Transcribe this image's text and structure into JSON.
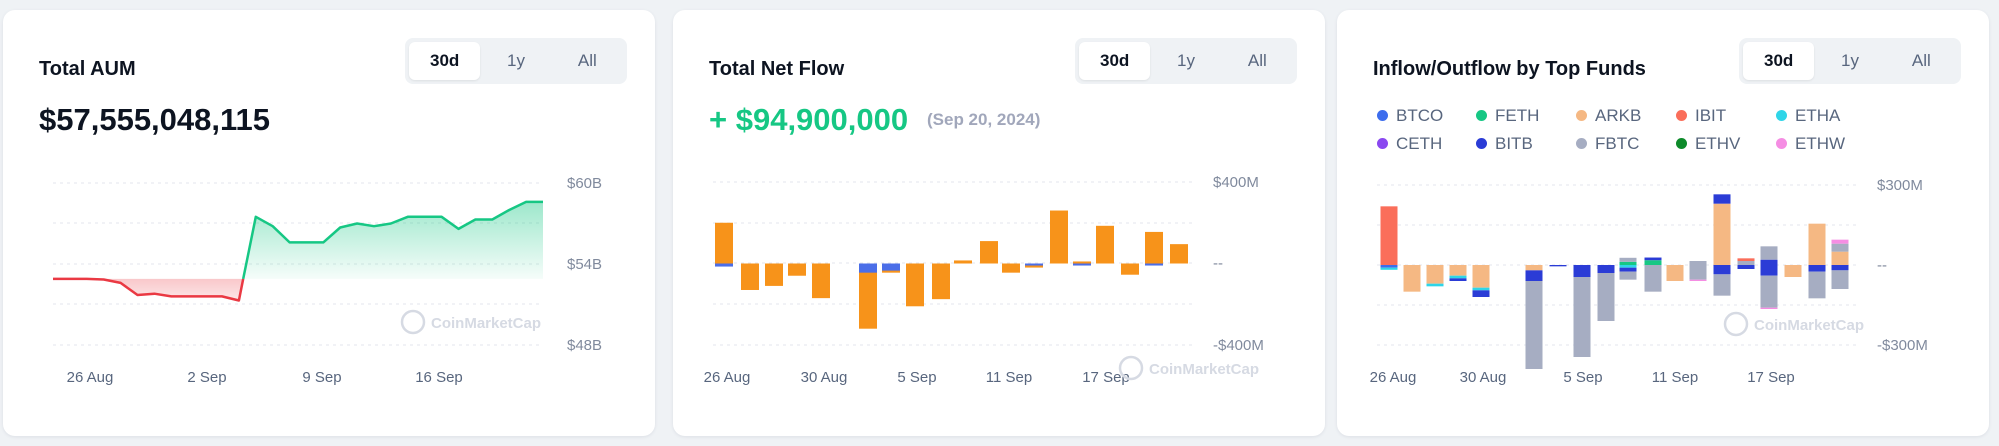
{
  "cards": {
    "aum": {
      "title": "Total AUM",
      "value": "$57,555,048,115",
      "tabs": [
        "30d",
        "1y",
        "All"
      ],
      "active_tab": "30d",
      "watermark": "CoinMarketCap"
    },
    "netflow": {
      "title": "Total Net Flow",
      "value": "+ $94,900,000",
      "date": "(Sep 20, 2024)",
      "tabs": [
        "30d",
        "1y",
        "All"
      ],
      "active_tab": "30d",
      "watermark": "CoinMarketCap"
    },
    "funds": {
      "title": "Inflow/Outflow by Top Funds",
      "tabs": [
        "30d",
        "1y",
        "All"
      ],
      "active_tab": "30d",
      "watermark": "CoinMarketCap"
    }
  },
  "colors": {
    "green": "#16c784",
    "red": "#ea3943",
    "orange": "#f7931a",
    "blue_bar": "#4b6ee8",
    "muted": "#58667e"
  },
  "chart_data": [
    {
      "type": "area",
      "title": "Total AUM",
      "xlabel": "",
      "ylabel": "",
      "x_ticks": [
        "26 Aug",
        "2 Sep",
        "9 Sep",
        "16 Sep"
      ],
      "y_ticks": [
        "$60B",
        "$54B",
        "$48B"
      ],
      "ylim": [
        48,
        60
      ],
      "baseline": 52.9,
      "grid": true,
      "x": [
        "25 Aug",
        "26 Aug",
        "27 Aug",
        "28 Aug",
        "29 Aug",
        "30 Aug",
        "31 Aug",
        "1 Sep",
        "2 Sep",
        "3 Sep",
        "4 Sep",
        "5 Sep",
        "6 Sep",
        "7 Sep",
        "8 Sep",
        "9 Sep",
        "10 Sep",
        "11 Sep",
        "12 Sep",
        "13 Sep",
        "14 Sep",
        "15 Sep",
        "16 Sep",
        "17 Sep",
        "18 Sep",
        "19 Sep",
        "20 Sep",
        "21 Sep",
        "22 Sep",
        "23 Sep"
      ],
      "values": [
        52.9,
        52.9,
        52.9,
        52.85,
        52.6,
        51.7,
        51.8,
        51.6,
        51.6,
        51.6,
        51.6,
        51.3,
        57.5,
        56.8,
        55.6,
        55.6,
        55.6,
        56.7,
        57.0,
        56.8,
        57.0,
        57.5,
        57.5,
        57.5,
        56.6,
        57.3,
        57.3,
        58.0,
        58.6,
        58.6
      ],
      "series_colors": {
        "down": "#ea3943",
        "up": "#16c784"
      }
    },
    {
      "type": "bar",
      "title": "Total Net Flow",
      "xlabel": "",
      "ylabel": "",
      "x_ticks": [
        "26 Aug",
        "30 Aug",
        "5 Sep",
        "11 Sep",
        "17 Sep"
      ],
      "y_ticks": [
        "$400M",
        "--",
        "-$400M"
      ],
      "ylim": [
        -400,
        400
      ],
      "grid": true,
      "x": [
        "23 Aug",
        "26 Aug",
        "27 Aug",
        "28 Aug",
        "29 Aug",
        "30 Aug",
        "3 Sep",
        "4 Sep",
        "5 Sep",
        "6 Sep",
        "9 Sep",
        "10 Sep",
        "11 Sep",
        "12 Sep",
        "13 Sep",
        "16 Sep",
        "17 Sep",
        "18 Sep",
        "19 Sep",
        "20 Sep"
      ],
      "series": [
        {
          "name": "",
          "color": "#f7931a",
          "values": [
            200,
            -130,
            -110,
            -60,
            -170,
            0,
            -320,
            -45,
            -210,
            -175,
            15,
            110,
            -45,
            -20,
            260,
            10,
            185,
            -55,
            155,
            95
          ]
        },
        {
          "name": "",
          "color": "#4b6ee8",
          "values": [
            -15,
            0,
            0,
            0,
            0,
            0,
            -45,
            -35,
            0,
            0,
            0,
            0,
            0,
            -10,
            0,
            -10,
            0,
            0,
            -10,
            0
          ]
        }
      ]
    },
    {
      "type": "bar",
      "stacked": true,
      "title": "Inflow/Outflow by Top Funds",
      "xlabel": "",
      "ylabel": "",
      "legend_position": "top",
      "x_ticks": [
        "26 Aug",
        "30 Aug",
        "5 Sep",
        "11 Sep",
        "17 Sep"
      ],
      "y_ticks": [
        "$300M",
        "--",
        "-$300M"
      ],
      "ylim": [
        -300,
        300
      ],
      "grid": true,
      "x": [
        "23 Aug",
        "26 Aug",
        "27 Aug",
        "28 Aug",
        "29 Aug",
        "30 Aug",
        "3 Sep",
        "4 Sep",
        "5 Sep",
        "6 Sep",
        "9 Sep",
        "10 Sep",
        "11 Sep",
        "12 Sep",
        "13 Sep",
        "16 Sep",
        "17 Sep",
        "18 Sep",
        "19 Sep",
        "20 Sep"
      ],
      "series": [
        {
          "name": "BTCO",
          "color": "#3d6ded",
          "values": [
            -10,
            0,
            0,
            0,
            0,
            0,
            0,
            0,
            0,
            0,
            0,
            0,
            0,
            0,
            0,
            0,
            0,
            0,
            0,
            0
          ]
        },
        {
          "name": "FETH",
          "color": "#16c784",
          "values": [
            0,
            0,
            0,
            0,
            0,
            0,
            0,
            0,
            0,
            0,
            12,
            18,
            0,
            0,
            0,
            0,
            0,
            0,
            0,
            0
          ]
        },
        {
          "name": "ARKB",
          "color": "#f5b883",
          "values": [
            0,
            -100,
            -70,
            -40,
            -85,
            0,
            -20,
            0,
            0,
            0,
            0,
            0,
            -60,
            0,
            230,
            0,
            0,
            -45,
            155,
            50
          ]
        },
        {
          "name": "IBIT",
          "color": "#fa6e5a",
          "values": [
            220,
            0,
            0,
            0,
            0,
            0,
            0,
            0,
            0,
            0,
            0,
            0,
            0,
            0,
            0,
            0,
            0,
            0,
            0,
            0
          ]
        },
        {
          "name": "ETHA",
          "color": "#2fd5e8",
          "values": [
            -8,
            0,
            -10,
            -10,
            -10,
            0,
            0,
            0,
            0,
            0,
            -10,
            0,
            0,
            0,
            0,
            0,
            0,
            0,
            0,
            0
          ]
        },
        {
          "name": "CETH",
          "color": "#8a48f0",
          "values": [
            0,
            0,
            0,
            0,
            0,
            0,
            0,
            0,
            0,
            0,
            0,
            0,
            0,
            0,
            0,
            0,
            0,
            0,
            0,
            0
          ]
        },
        {
          "name": "BITB",
          "color": "#2b3cd6",
          "values": [
            0,
            0,
            0,
            -10,
            -25,
            0,
            -40,
            -5,
            -45,
            -30,
            -15,
            0,
            0,
            0,
            -35,
            -15,
            -40,
            0,
            -25,
            -20
          ]
        },
        {
          "name": "FBTC",
          "color": "#a6adc2",
          "values": [
            0,
            0,
            0,
            0,
            0,
            0,
            -330,
            0,
            -300,
            -180,
            -30,
            -100,
            0,
            -55,
            -80,
            0,
            -120,
            0,
            -100,
            -70
          ]
        },
        {
          "name": "ETHV",
          "color": "#0d8a2a",
          "values": [
            0,
            0,
            0,
            0,
            0,
            0,
            0,
            0,
            0,
            0,
            0,
            0,
            0,
            0,
            0,
            0,
            0,
            0,
            0,
            0
          ]
        },
        {
          "name": "ETHW",
          "color": "#f58de3",
          "values": [
            0,
            0,
            0,
            0,
            0,
            0,
            0,
            0,
            0,
            0,
            0,
            0,
            0,
            -5,
            0,
            0,
            -5,
            0,
            0,
            0
          ]
        }
      ],
      "positive_stack_extra": {
        "BITB": [
          0,
          0,
          0,
          0,
          0,
          0,
          0,
          0,
          0,
          0,
          0,
          10,
          0,
          0,
          35,
          0,
          20,
          0,
          0,
          0
        ],
        "FBTC": [
          0,
          0,
          0,
          0,
          0,
          0,
          0,
          0,
          0,
          0,
          15,
          0,
          0,
          15,
          0,
          15,
          50,
          0,
          0,
          30
        ],
        "IBIT": [
          0,
          0,
          0,
          0,
          0,
          0,
          0,
          0,
          0,
          0,
          0,
          0,
          0,
          0,
          0,
          10,
          0,
          0,
          0,
          0
        ],
        "ETHW": [
          0,
          0,
          0,
          0,
          0,
          0,
          0,
          0,
          0,
          0,
          0,
          0,
          0,
          0,
          0,
          0,
          0,
          0,
          0,
          15
        ]
      }
    }
  ]
}
